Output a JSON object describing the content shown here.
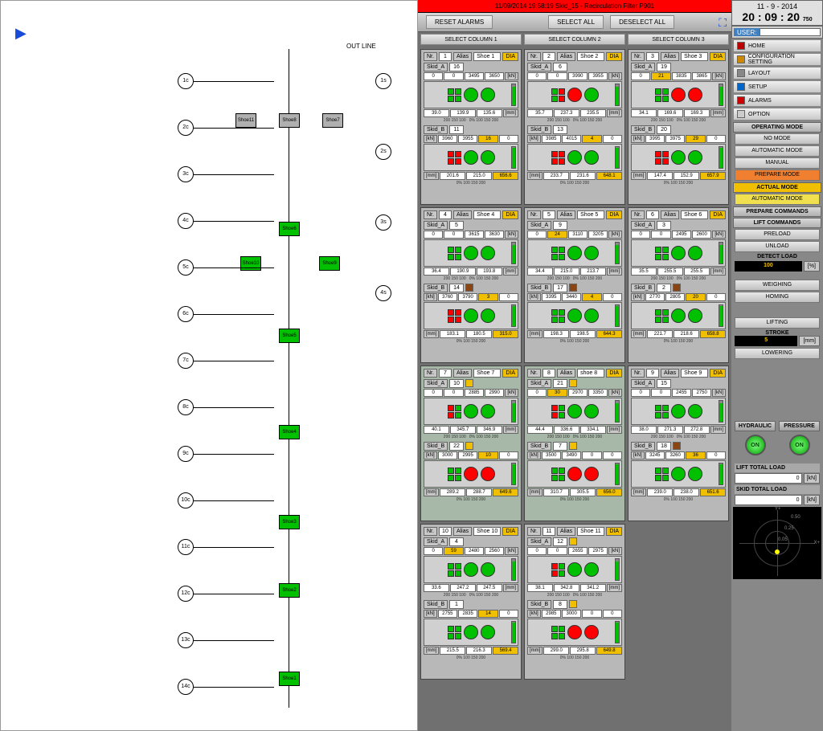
{
  "alarm_bar": "11/09/2014 19:58:19 Skid_15 - Recirculation Filter P901",
  "datetime": {
    "date": "11 - 9 - 2014",
    "time": "20 : 09 : 20",
    "ms": "750"
  },
  "user_label": "USER:",
  "toolbar": {
    "reset": "RESET ALARMS",
    "select_all": "SELECT ALL",
    "deselect_all": "DESELECT ALL"
  },
  "col_select": [
    "SELECT COLUMN 1",
    "SELECT COLUMN 2",
    "SELECT COLUMN 3"
  ],
  "card_labels": {
    "nr": "Nr.",
    "alias": "Alias",
    "dia": "DIA",
    "kn": "[kN]",
    "mm": "[mm]"
  },
  "menu": {
    "home": "HOME",
    "config": "CONFIGURATION SETTING",
    "layout": "LAYOUT",
    "setup": "SETUP",
    "alarms": "ALARMS",
    "option": "OPTION"
  },
  "op_mode_hdr": "OPERATING MODE",
  "op_modes": {
    "no": "NO MODE",
    "auto": "AUTOMATIC MODE",
    "manual": "MANUAL",
    "prepare": "PREPARE MODE"
  },
  "actual_hdr": "ACTUAL MODE",
  "actual_mode": "AUTOMATIC MODE",
  "prep_hdr": "PREPARE COMMANDS",
  "lift_cmd_hdr": "LIFT COMMANDS",
  "cmds": {
    "preload": "PRELOAD",
    "unload": "UNLOAD",
    "weighing": "WEIGHING",
    "homing": "HOMING",
    "lifting": "LIFTING",
    "lowering": "LOWERING"
  },
  "detect": {
    "hdr": "DETECT LOAD",
    "val": "100",
    "unit": "[%]"
  },
  "stroke": {
    "hdr": "STROKE",
    "val": "5",
    "unit": "[mm]"
  },
  "hyd": {
    "hydraulic": "HYDRAULIC",
    "pressure": "PRESSURE",
    "on": "ON"
  },
  "totals": {
    "lift": "LIFT TOTAL LOAD",
    "skid": "SKID TOTAL LOAD",
    "lift_v": "0",
    "skid_v": "0",
    "unit": "[kN]"
  },
  "diagram": {
    "outline": "OUT LINE",
    "shoes": [
      "Shoe1",
      "Shoe2",
      "Shoe3",
      "Shoe4",
      "Shoe5",
      "Shoe6",
      "Shoe7",
      "Shoe8",
      "Shoe9",
      "Shoe10",
      "Shoe11"
    ],
    "left_labels": [
      "1c",
      "2c",
      "3c",
      "4c",
      "5c",
      "6c",
      "7c",
      "8c",
      "9c",
      "10c",
      "11c",
      "12c",
      "13c",
      "14c"
    ],
    "right_labels": [
      "1s",
      "2s",
      "3s",
      "4s"
    ]
  },
  "cards": [
    {
      "nr": "1",
      "alias": "Shoe 1",
      "sel": false,
      "skA": "16",
      "skA_ind": "",
      "loadA": [
        "0",
        "0",
        "3495",
        "3650"
      ],
      "mmA": [
        "39.0",
        "139.9",
        "135.6"
      ],
      "gA": [
        "g",
        "g",
        "g",
        "g"
      ],
      "skB": "11",
      "skB_ind": "",
      "loadB": [
        "3960",
        "3955",
        "16",
        "0"
      ],
      "mmB": [
        "201.6",
        "215.0",
        "656.6"
      ],
      "gB": [
        "r",
        "r",
        "g",
        "g"
      ]
    },
    {
      "nr": "2",
      "alias": "Shoe 2",
      "sel": false,
      "skA": "6",
      "skA_ind": "",
      "loadA": [
        "0",
        "0",
        "3990",
        "3955"
      ],
      "mmA": [
        "35.7",
        "237.3",
        "235.5"
      ],
      "gA": [
        "g",
        "r",
        "r",
        "g"
      ],
      "skB": "13",
      "skB_ind": "",
      "loadB": [
        "3985",
        "4015",
        "4",
        "0"
      ],
      "mmB": [
        "233.7",
        "231.6",
        "648.1"
      ],
      "gB": [
        "r",
        "r",
        "g",
        "g"
      ]
    },
    {
      "nr": "3",
      "alias": "Shoe 3",
      "sel": false,
      "skA": "19",
      "skA_ind": "",
      "loadA": [
        "0",
        "21",
        "3835",
        "3865"
      ],
      "mmA": [
        "34.1",
        "169.6",
        "169.3"
      ],
      "gA": [
        "g",
        "g",
        "r",
        "r"
      ],
      "skB": "20",
      "skB_ind": "",
      "loadB": [
        "3995",
        "3975",
        "29",
        "0"
      ],
      "mmB": [
        "147.4",
        "152.9",
        "657.9"
      ],
      "gB": [
        "r",
        "r",
        "g",
        "g"
      ]
    },
    {
      "nr": "4",
      "alias": "Shoe 4",
      "sel": false,
      "skA": "5",
      "skA_ind": "",
      "loadA": [
        "0",
        "0",
        "3615",
        "3630"
      ],
      "mmA": [
        "36.4",
        "190.9",
        "193.8"
      ],
      "gA": [
        "g",
        "g",
        "g",
        "g"
      ],
      "skB": "14",
      "skB_ind": "b",
      "loadB": [
        "3760",
        "3790",
        "3",
        "0"
      ],
      "mmB": [
        "183.1",
        "180.5",
        "315.0"
      ],
      "gB": [
        "r",
        "r",
        "g",
        "g"
      ]
    },
    {
      "nr": "5",
      "alias": "Shoe 5",
      "sel": false,
      "skA": "9",
      "skA_ind": "",
      "loadA": [
        "0",
        "24",
        "3110",
        "3205"
      ],
      "mmA": [
        "34.4",
        "215.0",
        "213.7"
      ],
      "gA": [
        "g",
        "g",
        "g",
        "g"
      ],
      "skB": "17",
      "skB_ind": "b",
      "loadB": [
        "3395",
        "3440",
        "4",
        "0"
      ],
      "mmB": [
        "198.3",
        "198.5",
        "644.3"
      ],
      "gB": [
        "g",
        "g",
        "g",
        "g"
      ]
    },
    {
      "nr": "6",
      "alias": "Shoe 6",
      "sel": false,
      "skA": "3",
      "skA_ind": "",
      "loadA": [
        "0",
        "0",
        "2495",
        "2600"
      ],
      "mmA": [
        "35.5",
        "255.5",
        "255.5"
      ],
      "gA": [
        "g",
        "g",
        "g",
        "g"
      ],
      "skB": "2",
      "skB_ind": "b",
      "loadB": [
        "2770",
        "2805",
        "20",
        "0"
      ],
      "mmB": [
        "221.7",
        "218.6",
        "658.8"
      ],
      "gB": [
        "g",
        "g",
        "g",
        "g"
      ]
    },
    {
      "nr": "7",
      "alias": "Shoe 7",
      "sel": true,
      "skA": "10",
      "skA_ind": "y",
      "loadA": [
        "0",
        "0",
        "2885",
        "2990"
      ],
      "mmA": [
        "40.1",
        "345.7",
        "346.9"
      ],
      "gA": [
        "r",
        "g",
        "g",
        "g"
      ],
      "skB": "22",
      "skB_ind": "y",
      "loadB": [
        "3000",
        "2995",
        "10",
        "0"
      ],
      "mmB": [
        "289.2",
        "288.7",
        "649.6"
      ],
      "gB": [
        "g",
        "g",
        "r",
        "r"
      ]
    },
    {
      "nr": "8",
      "alias": "shoe 8",
      "sel": true,
      "skA": "21",
      "skA_ind": "y",
      "loadA": [
        "0",
        "30",
        "2970",
        "3350"
      ],
      "mmA": [
        "44.4",
        "336.6",
        "334.1"
      ],
      "gA": [
        "r",
        "g",
        "g",
        "g"
      ],
      "skB": "7",
      "skB_ind": "y",
      "loadB": [
        "3500",
        "3490",
        "0",
        "0"
      ],
      "mmB": [
        "310.7",
        "305.5",
        "656.0"
      ],
      "gB": [
        "g",
        "g",
        "r",
        "r"
      ]
    },
    {
      "nr": "9",
      "alias": "Shoe 9",
      "sel": false,
      "skA": "15",
      "skA_ind": "",
      "loadA": [
        "0",
        "0",
        "2455",
        "2750"
      ],
      "mmA": [
        "38.0",
        "271.3",
        "272.8"
      ],
      "gA": [
        "g",
        "g",
        "g",
        "g"
      ],
      "skB": "18",
      "skB_ind": "b",
      "loadB": [
        "3245",
        "3260",
        "36",
        "0"
      ],
      "mmB": [
        "239.0",
        "238.0",
        "651.6"
      ],
      "gB": [
        "g",
        "g",
        "g",
        "g"
      ]
    },
    {
      "nr": "10",
      "alias": "Shoe 10",
      "sel": false,
      "skA": "4",
      "skA_ind": "",
      "loadA": [
        "0",
        "59",
        "2480",
        "2560"
      ],
      "mmA": [
        "33.6",
        "247.2",
        "247.5"
      ],
      "gA": [
        "g",
        "g",
        "g",
        "g"
      ],
      "skB": "1",
      "skB_ind": "",
      "loadB": [
        "2755",
        "2835",
        "14",
        "0"
      ],
      "mmB": [
        "215.5",
        "216.3",
        "569.4"
      ],
      "gB": [
        "g",
        "g",
        "g",
        "g"
      ]
    },
    {
      "nr": "11",
      "alias": "Shoe 11",
      "sel": false,
      "skA": "12",
      "skA_ind": "y",
      "loadA": [
        "0",
        "0",
        "2655",
        "2975"
      ],
      "mmA": [
        "38.1",
        "342.8",
        "341.2"
      ],
      "gA": [
        "r",
        "g",
        "g",
        "g"
      ],
      "skB": "8",
      "skB_ind": "y",
      "loadB": [
        "2985",
        "3000",
        "0",
        "0"
      ],
      "mmB": [
        "299.0",
        "295.8",
        "649.8"
      ],
      "gB": [
        "g",
        "g",
        "r",
        "r"
      ]
    }
  ],
  "scale_txt_a": "200  150  100",
  "scale_txt_b": "0%     100  150  200",
  "radar": {
    "xp": "X+",
    "yp": "Y+",
    "r1": "0.50",
    "r2": "0.25",
    "r3": "0.05"
  }
}
